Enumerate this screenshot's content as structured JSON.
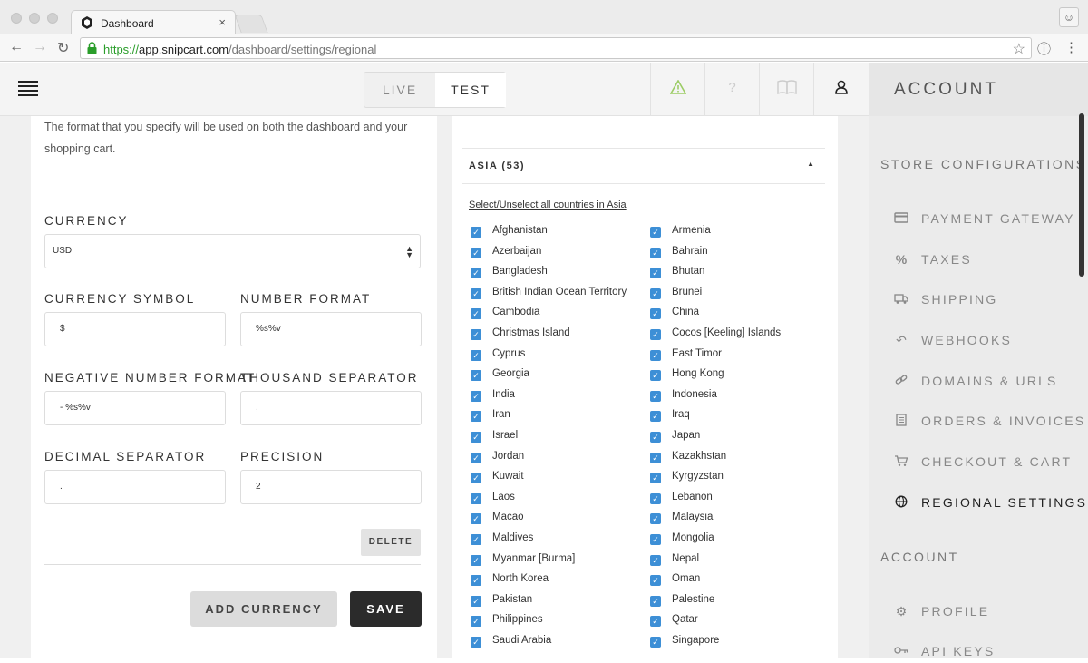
{
  "browser": {
    "tab_title": "Dashboard",
    "tab_close": "×",
    "url_protocol": "https://",
    "url_host": "app.snipcart.com",
    "url_path": "/dashboard/settings/regional",
    "icons": [
      "back-icon",
      "forward-icon",
      "reload-icon",
      "lock-icon",
      "star-icon",
      "info-icon",
      "menu-dots-icon",
      "profile-icon"
    ]
  },
  "header": {
    "env_live": "LIVE",
    "env_test": "TEST",
    "icons": [
      "hamburger-icon",
      "warning-icon",
      "help-icon",
      "docs-book-icon",
      "user-icon"
    ],
    "colors": {
      "warning": "#9ccc65"
    }
  },
  "sidebar": {
    "title": "ACCOUNT",
    "section_store": "STORE CONFIGURATIONS",
    "store_items": [
      {
        "label": "PAYMENT GATEWAY",
        "icon": "credit-card-icon"
      },
      {
        "label": "TAXES",
        "icon": "percent-icon"
      },
      {
        "label": "SHIPPING",
        "icon": "truck-icon"
      },
      {
        "label": "WEBHOOKS",
        "icon": "undo-icon"
      },
      {
        "label": "DOMAINS & URLS",
        "icon": "link-icon"
      },
      {
        "label": "ORDERS & INVOICES",
        "icon": "document-icon"
      },
      {
        "label": "CHECKOUT & CART",
        "icon": "cart-icon"
      },
      {
        "label": "REGIONAL SETTINGS",
        "icon": "globe-icon",
        "active": true
      }
    ],
    "section_account": "ACCOUNT",
    "account_items": [
      {
        "label": "PROFILE",
        "icon": "gear-icon"
      },
      {
        "label": "API KEYS",
        "icon": "key-icon"
      }
    ]
  },
  "currency_form": {
    "intro": "The format that you specify will be used on both the dashboard and your shopping cart.",
    "currency_label": "CURRENCY",
    "currency_value": "USD",
    "currency_symbol_label": "CURRENCY SYMBOL",
    "currency_symbol_value": "$",
    "number_format_label": "NUMBER FORMAT",
    "number_format_value": "%s%v",
    "negative_format_label": "NEGATIVE NUMBER FORMAT",
    "negative_format_value": "- %s%v",
    "thousand_sep_label": "THOUSAND SEPARATOR",
    "thousand_sep_value": ",",
    "decimal_sep_label": "DECIMAL SEPARATOR",
    "decimal_sep_value": ".",
    "precision_label": "PRECISION",
    "precision_value": "2",
    "delete_label": "DELETE",
    "add_currency_label": "ADD CURRENCY",
    "save_label": "SAVE"
  },
  "countries": {
    "region_title": "ASIA (53)",
    "toggle_all": "Select/Unselect all countries in Asia",
    "checked_mark": "✓",
    "check_color": "#3d8fd6",
    "left_column": [
      "Afghanistan",
      "Azerbaijan",
      "Bangladesh",
      "British Indian Ocean Territory",
      "Cambodia",
      "Christmas Island",
      "Cyprus",
      "Georgia",
      "India",
      "Iran",
      "Israel",
      "Jordan",
      "Kuwait",
      "Laos",
      "Macao",
      "Maldives",
      "Myanmar [Burma]",
      "North Korea",
      "Pakistan",
      "Philippines",
      "Saudi Arabia"
    ],
    "right_column": [
      "Armenia",
      "Bahrain",
      "Bhutan",
      "Brunei",
      "China",
      "Cocos [Keeling] Islands",
      "East Timor",
      "Hong Kong",
      "Indonesia",
      "Iraq",
      "Japan",
      "Kazakhstan",
      "Kyrgyzstan",
      "Lebanon",
      "Malaysia",
      "Mongolia",
      "Nepal",
      "Oman",
      "Palestine",
      "Qatar",
      "Singapore"
    ]
  }
}
